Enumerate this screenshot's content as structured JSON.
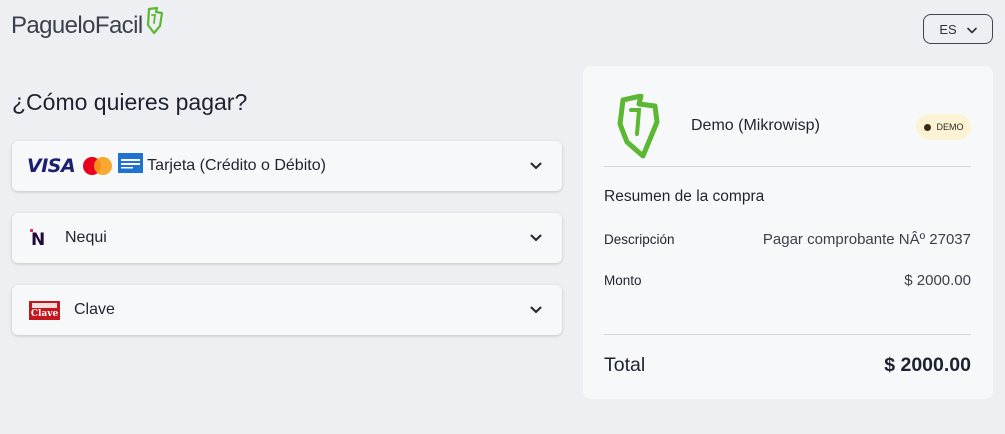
{
  "brand": {
    "logo_text": "PagueloFacil"
  },
  "lang": {
    "code": "ES"
  },
  "page": {
    "heading": "¿Cómo quieres pagar?"
  },
  "payment_methods": [
    {
      "label": "Tarjeta (Crédito o Débito)",
      "icons": [
        "visa-logo",
        "mastercard-logo",
        "amex-logo"
      ],
      "visa_text": "VISA"
    },
    {
      "label": "Nequi",
      "icons": [
        "nequi-logo"
      ],
      "icon_text": "N"
    },
    {
      "label": "Clave",
      "icons": [
        "clave-logo"
      ],
      "icon_text": "Clave"
    }
  ],
  "summary": {
    "merchant": "Demo (Mikrowisp)",
    "badge": "DEMO",
    "title": "Resumen de la compra",
    "description_label": "Descripción",
    "description_value": "Pagar comprobante NÂº 27037",
    "amount_label": "Monto",
    "amount_value": "$ 2000.00",
    "total_label": "Total",
    "total_value": "$ 2000.00"
  },
  "colors": {
    "brand_green": "#5cb832",
    "background": "#eeeff2",
    "card": "#f7f8f9",
    "badge_bg": "#fcf3d4"
  }
}
